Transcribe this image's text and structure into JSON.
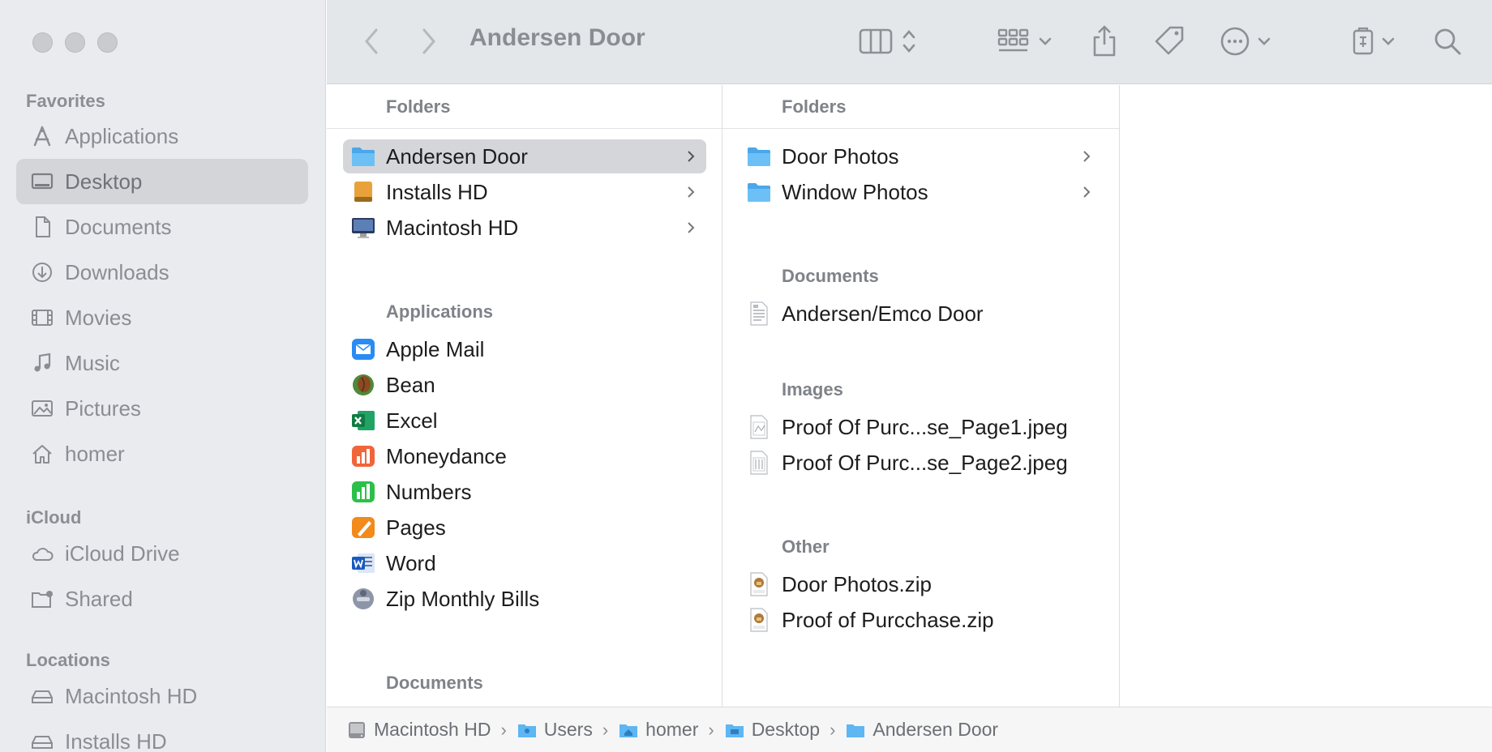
{
  "window": {
    "title": "Andersen Door"
  },
  "sidebar": {
    "favorites_label": "Favorites",
    "favorites": [
      {
        "label": "Applications",
        "icon": "applications-icon"
      },
      {
        "label": "Desktop",
        "icon": "desktop-icon",
        "selected": true
      },
      {
        "label": "Documents",
        "icon": "documents-icon"
      },
      {
        "label": "Downloads",
        "icon": "downloads-icon"
      },
      {
        "label": "Movies",
        "icon": "movies-icon"
      },
      {
        "label": "Music",
        "icon": "music-icon"
      },
      {
        "label": "Pictures",
        "icon": "pictures-icon"
      },
      {
        "label": "homer",
        "icon": "home-icon"
      }
    ],
    "icloud_label": "iCloud",
    "icloud": [
      {
        "label": "iCloud Drive",
        "icon": "cloud-icon"
      },
      {
        "label": "Shared",
        "icon": "shared-folder-icon"
      }
    ],
    "locations_label": "Locations",
    "locations": [
      {
        "label": "Macintosh HD",
        "icon": "disk-icon"
      },
      {
        "label": "Installs HD",
        "icon": "disk-icon"
      }
    ]
  },
  "column1": {
    "folders_label": "Folders",
    "folders": [
      "Andersen Door",
      "Installs HD",
      "Macintosh HD"
    ],
    "applications_label": "Applications",
    "applications": [
      "Apple Mail",
      "Bean",
      "Excel",
      "Moneydance",
      "Numbers",
      "Pages",
      "Word",
      "Zip Monthly Bills"
    ],
    "documents_label": "Documents"
  },
  "column2": {
    "folders_label": "Folders",
    "folders": [
      "Door Photos",
      "Window Photos"
    ],
    "documents_label": "Documents",
    "documents": [
      "Andersen/Emco Door"
    ],
    "images_label": "Images",
    "images": [
      "Proof Of Purc...se_Page1.jpeg",
      "Proof Of Purc...se_Page2.jpeg"
    ],
    "other_label": "Other",
    "other": [
      "Door Photos.zip",
      "Proof of Purcchase.zip"
    ]
  },
  "pathbar": [
    "Macintosh HD",
    "Users",
    "homer",
    "Desktop",
    "Andersen Door"
  ],
  "colors": {
    "folder": "#5eb6f2",
    "sidebar_bg": "#e9ebef",
    "selection": "#d5d6d9"
  }
}
